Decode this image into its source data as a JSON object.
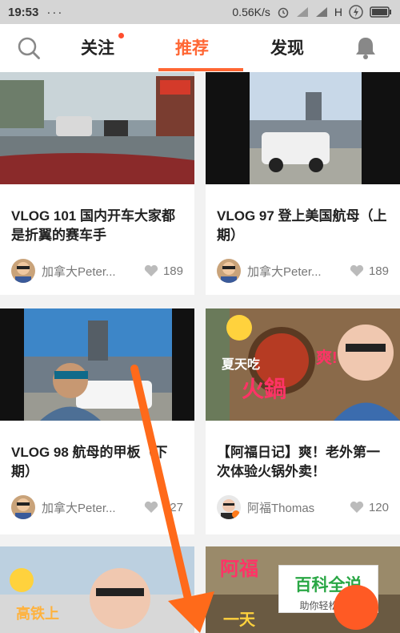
{
  "status_bar": {
    "time": "19:53",
    "speed": "0.56K/s",
    "network": "H"
  },
  "nav": {
    "tabs": [
      {
        "label": "关注"
      },
      {
        "label": "推荐"
      },
      {
        "label": "发现"
      }
    ],
    "active_tab": "推荐",
    "accent_color": "#ff6633"
  },
  "feed": [
    {
      "title": "VLOG 101 国内开车大家都是折翼的赛车手",
      "author": "加拿大Peter...",
      "likes": "189"
    },
    {
      "title": "VLOG 97 登上美国航母（上期）",
      "author": "加拿大Peter...",
      "likes": "189"
    },
    {
      "title": "VLOG 98 航母的甲板（下期）",
      "author": "加拿大Peter...",
      "likes": "127"
    },
    {
      "title": "【阿福日记】爽！老外第一次体验火锅外卖！",
      "author": "阿福Thomas",
      "likes": "120"
    }
  ],
  "thumb_text": {
    "hotpot_1": "夏天吃",
    "hotpot_2": "火鍋",
    "hotpot_3": "爽!",
    "train": "高铁上",
    "afu_1": "阿福",
    "afu_2": "一天"
  },
  "watermark": {
    "main": "百科全说",
    "sub": "助你轻松解决"
  }
}
